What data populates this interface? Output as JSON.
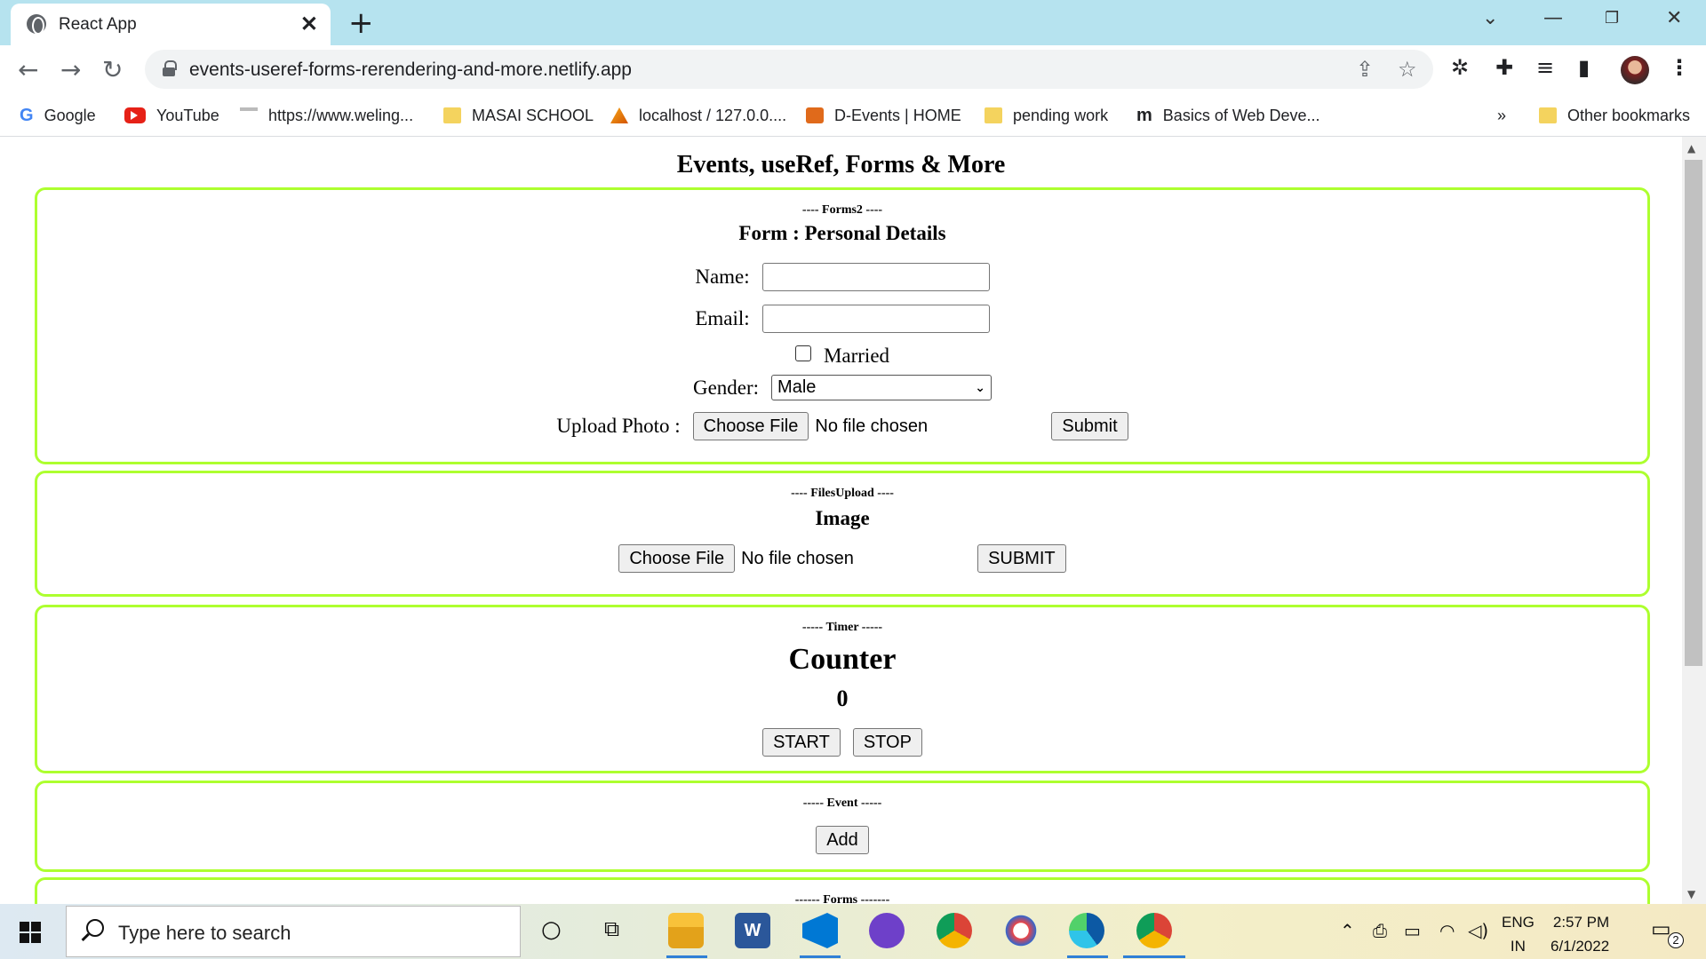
{
  "browser": {
    "tab_title": "React App",
    "url": "events-useref-forms-rerendering-and-more.netlify.app",
    "bookmarks": [
      {
        "label": "Google",
        "icon": "google-icon"
      },
      {
        "label": "YouTube",
        "icon": "youtube-icon"
      },
      {
        "label": "https://www.weling...",
        "icon": "site-icon"
      },
      {
        "label": "MASAI SCHOOL",
        "icon": "folder-icon"
      },
      {
        "label": "localhost / 127.0.0....",
        "icon": "phpmyadmin-icon"
      },
      {
        "label": "D-Events | HOME",
        "icon": "devents-icon"
      },
      {
        "label": "pending work",
        "icon": "folder-icon"
      },
      {
        "label": "Basics of Web Deve...",
        "icon": "m-icon"
      }
    ],
    "overflow": "»",
    "other_bookmarks": "Other bookmarks"
  },
  "page": {
    "title": "Events, useRef, Forms & More",
    "forms2": {
      "label": "---- Forms2 ----",
      "heading": "Form : Personal Details",
      "name_label": "Name:",
      "email_label": "Email:",
      "married_label": "Married",
      "gender_label": "Gender:",
      "gender_value": "Male",
      "upload_label": "Upload Photo :",
      "choose_file": "Choose File",
      "no_file": "No file chosen",
      "submit": "Submit"
    },
    "files_upload": {
      "label": "---- FilesUpload ----",
      "heading": "Image",
      "choose_file": "Choose File",
      "no_file": "No file chosen",
      "submit": "SUBMIT"
    },
    "timer": {
      "label": "----- Timer -----",
      "heading": "Counter",
      "count": "0",
      "start": "START",
      "stop": "STOP"
    },
    "event": {
      "label": "----- Event -----",
      "add": "Add"
    },
    "forms": {
      "label": "------ Forms -------"
    }
  },
  "taskbar": {
    "search_placeholder": "Type here to search",
    "lang_top": "ENG",
    "lang_bottom": "IN",
    "time": "2:57 PM",
    "date": "6/1/2022",
    "notifications": "2"
  },
  "colors": {
    "card_border": "#adff2f",
    "tab_strip": "#b6e3ef"
  }
}
